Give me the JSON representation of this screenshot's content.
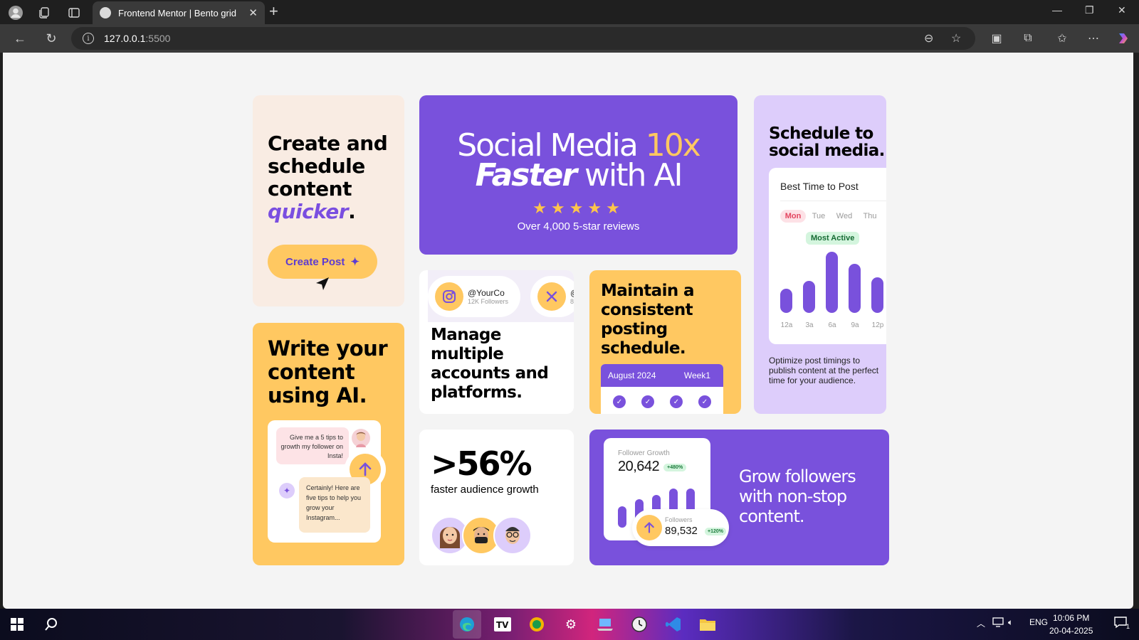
{
  "browser": {
    "tab_title": "Frontend Mentor | Bento grid",
    "url_host": "127.0.0.1",
    "url_port": ":5500"
  },
  "cards": {
    "create": {
      "line1": "Create and",
      "line2": "schedule",
      "line3": "content",
      "highlight": "quicker",
      "period": ".",
      "button": "Create Post"
    },
    "hero": {
      "part1": "Social Media ",
      "highlight": "10x",
      "italic": "Faster",
      "part2": " with AI",
      "stars": "★★★★★",
      "reviews": "Over 4,000 5-star reviews"
    },
    "schedule": {
      "title_line1": "Schedule to",
      "title_line2": "social media.",
      "widget_title": "Best Time to Post",
      "days": [
        "Mon",
        "Tue",
        "Wed",
        "Thu"
      ],
      "badge": "Most Active",
      "bar_labels": [
        "12a",
        "3a",
        "6a",
        "9a",
        "12p"
      ],
      "bar_levels": [
        0.4,
        0.52,
        1.0,
        0.8,
        0.58
      ],
      "description": "Optimize post timings to publish content at the perfect time for your audience."
    },
    "write": {
      "line1": "Write your",
      "line2": "content",
      "line3": "using AI.",
      "user_msg": "Give me a 5 tips to growth my follower on Insta!",
      "ai_msg": "Certainly! Here are five tips to help you grow your Instagram..."
    },
    "manage": {
      "acc1_name": "@YourCo",
      "acc1_sub": "12K Followers",
      "acc2_name": "@",
      "acc2_sub": "8",
      "line1": "Manage",
      "line2": "multiple",
      "line3": "accounts and",
      "line4": "platforms."
    },
    "maintain": {
      "line1": "Maintain a",
      "line2": "consistent",
      "line3": "posting",
      "line4": "schedule.",
      "month": "August 2024",
      "week": "Week1",
      "checks": [
        "✓",
        "✓",
        "✓",
        "✓"
      ]
    },
    "stat": {
      "value": ">56%",
      "label": "faster audience growth"
    },
    "grow": {
      "fg_label": "Follower Growth",
      "fg_value": "20,642",
      "fg_pill": "+480%",
      "fol_label": "Followers",
      "fol_value": "89,532",
      "fol_pill": "+120%",
      "fg_bar_levels": [
        0.5,
        0.66,
        0.76,
        0.92,
        0.92
      ],
      "line1": "Grow followers",
      "line2": "with non-stop",
      "line3": "content."
    }
  },
  "taskbar": {
    "lang": "ENG",
    "time": "10:06 PM",
    "date": "20-04-2025",
    "notif_count": "1"
  },
  "colors": {
    "purple": "#7951dc",
    "yellow": "#ffc861",
    "peach": "#f9ece3",
    "lavender": "#ddcdfb"
  }
}
